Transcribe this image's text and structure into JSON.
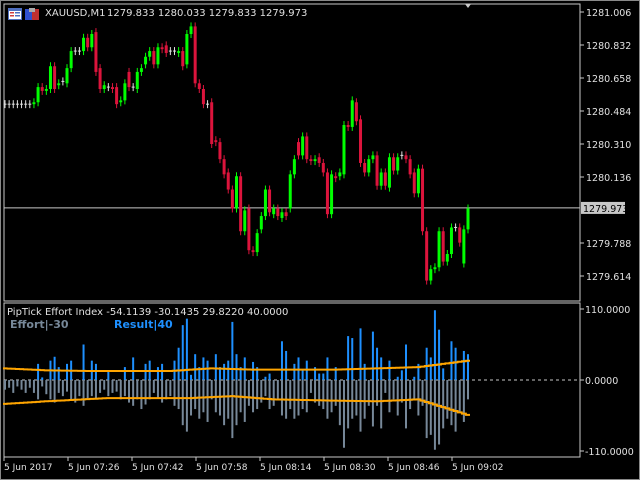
{
  "window": {
    "symbol_timeframe": "XAUUSD,M1",
    "ohlc_readout": "1279.833 1280.033 1279.833 1279.973",
    "current_price_label": "1279.973"
  },
  "indicator": {
    "title": "PipTick Effort Index -54.1139 -30.1435 29.8220 40.0000",
    "effort_label": "Effort|-30",
    "result_label": "Result|40",
    "axis_labels": [
      {
        "value": 110,
        "text": "110.0000"
      },
      {
        "value": 0,
        "text": "0.0000"
      },
      {
        "value": -110,
        "text": "-110.0000"
      }
    ]
  },
  "colors": {
    "bull": "#00ff00",
    "bear": "#dc143c",
    "doji": "#e0e0e0",
    "result": "#1e90ff",
    "effort": "#778899",
    "band": "#ffa500",
    "grid": "#c8c8c8"
  },
  "chart_data": {
    "type": "candlestick",
    "symbol": "XAUUSD",
    "timeframe": "M1",
    "price_axis_labels": [
      "1281.006",
      "1280.832",
      "1280.658",
      "1280.484",
      "1280.310",
      "1280.136",
      "1279.788",
      "1279.614"
    ],
    "current_price": 1279.973,
    "time_axis_labels": [
      "5 Jun 2017",
      "5 Jun 07:26",
      "5 Jun 07:42",
      "5 Jun 07:58",
      "5 Jun 08:14",
      "5 Jun 08:30",
      "5 Jun 08:46",
      "5 Jun 09:02"
    ],
    "candles_oc": [
      [
        1280.52,
        1280.52
      ],
      [
        1280.52,
        1280.52
      ],
      [
        1280.52,
        1280.52
      ],
      [
        1280.52,
        1280.52
      ],
      [
        1280.52,
        1280.52
      ],
      [
        1280.52,
        1280.52
      ],
      [
        1280.52,
        1280.52
      ],
      [
        1280.52,
        1280.53
      ],
      [
        1280.53,
        1280.61
      ],
      [
        1280.61,
        1280.59
      ],
      [
        1280.59,
        1280.6
      ],
      [
        1280.6,
        1280.72
      ],
      [
        1280.72,
        1280.6
      ],
      [
        1280.62,
        1280.63
      ],
      [
        1280.64,
        1280.64
      ],
      [
        1280.63,
        1280.71
      ],
      [
        1280.71,
        1280.8
      ],
      [
        1280.8,
        1280.8
      ],
      [
        1280.8,
        1280.8
      ],
      [
        1280.8,
        1280.87
      ],
      [
        1280.87,
        1280.82
      ],
      [
        1280.82,
        1280.89
      ],
      [
        1280.9,
        1280.69
      ],
      [
        1280.71,
        1280.6
      ],
      [
        1280.6,
        1280.62
      ],
      [
        1280.61,
        1280.61
      ],
      [
        1280.61,
        1280.6
      ],
      [
        1280.61,
        1280.52
      ],
      [
        1280.53,
        1280.54
      ],
      [
        1280.54,
        1280.63
      ],
      [
        1280.69,
        1280.61
      ],
      [
        1280.61,
        1280.61
      ],
      [
        1280.6,
        1280.69
      ],
      [
        1280.69,
        1280.71
      ],
      [
        1280.73,
        1280.77
      ],
      [
        1280.77,
        1280.8
      ],
      [
        1280.8,
        1280.73
      ],
      [
        1280.73,
        1280.82
      ],
      [
        1280.82,
        1280.81
      ],
      [
        1280.83,
        1280.79
      ],
      [
        1280.8,
        1280.8
      ],
      [
        1280.8,
        1280.8
      ],
      [
        1280.79,
        1280.8
      ],
      [
        1280.8,
        1280.72
      ],
      [
        1280.73,
        1280.89
      ],
      [
        1280.89,
        1280.93
      ],
      [
        1280.93,
        1280.63
      ],
      [
        1280.63,
        1280.6
      ],
      [
        1280.6,
        1280.52
      ],
      [
        1280.52,
        1280.52
      ],
      [
        1280.53,
        1280.31
      ],
      [
        1280.33,
        1280.32
      ],
      [
        1280.32,
        1280.23
      ],
      [
        1280.23,
        1280.15
      ],
      [
        1280.16,
        1280.07
      ],
      [
        1280.07,
        1279.97
      ],
      [
        1279.97,
        1280.14
      ],
      [
        1280.14,
        1279.85
      ],
      [
        1279.85,
        1279.96
      ],
      [
        1279.97,
        1279.75
      ],
      [
        1279.75,
        1279.74
      ],
      [
        1279.74,
        1279.84
      ],
      [
        1279.86,
        1279.93
      ],
      [
        1279.93,
        1280.07
      ],
      [
        1280.07,
        1279.95
      ],
      [
        1279.94,
        1279.97
      ],
      [
        1279.97,
        1279.93
      ],
      [
        1279.92,
        1279.95
      ],
      [
        1279.95,
        1279.93
      ],
      [
        1279.97,
        1280.15
      ],
      [
        1280.15,
        1280.23
      ],
      [
        1280.32,
        1280.25
      ],
      [
        1280.25,
        1280.35
      ],
      [
        1280.35,
        1280.23
      ],
      [
        1280.23,
        1280.22
      ],
      [
        1280.22,
        1280.23
      ],
      [
        1280.24,
        1280.21
      ],
      [
        1280.21,
        1280.16
      ],
      [
        1280.16,
        1279.94
      ],
      [
        1279.94,
        1280.15
      ],
      [
        1280.14,
        1280.13
      ],
      [
        1280.14,
        1280.16
      ],
      [
        1280.15,
        1280.41
      ],
      [
        1280.41,
        1280.4
      ],
      [
        1280.4,
        1280.54
      ],
      [
        1280.53,
        1280.43
      ],
      [
        1280.44,
        1280.21
      ],
      [
        1280.21,
        1280.16
      ],
      [
        1280.16,
        1280.23
      ],
      [
        1280.23,
        1280.25
      ],
      [
        1280.25,
        1280.09
      ],
      [
        1280.09,
        1280.16
      ],
      [
        1280.16,
        1280.09
      ],
      [
        1280.08,
        1280.24
      ],
      [
        1280.24,
        1280.17
      ],
      [
        1280.17,
        1280.24
      ],
      [
        1280.25,
        1280.25
      ],
      [
        1280.25,
        1280.23
      ],
      [
        1280.23,
        1280.15
      ],
      [
        1280.16,
        1280.05
      ],
      [
        1280.05,
        1280.18
      ],
      [
        1280.18,
        1279.85
      ],
      [
        1279.85,
        1279.59
      ],
      [
        1279.59,
        1279.65
      ],
      [
        1279.65,
        1279.66
      ],
      [
        1279.66,
        1279.85
      ],
      [
        1279.85,
        1279.69
      ],
      [
        1279.69,
        1279.73
      ],
      [
        1279.73,
        1279.87
      ],
      [
        1279.87,
        1279.87
      ],
      [
        1279.87,
        1279.79
      ],
      [
        1279.68,
        1279.86
      ],
      [
        1279.86,
        1279.97
      ]
    ],
    "indicator_result": [
      0,
      0,
      0,
      0,
      0,
      0,
      0,
      0,
      25,
      4,
      0,
      30,
      36,
      20,
      0,
      25,
      30,
      0,
      0,
      55,
      0,
      30,
      25,
      0,
      0,
      15,
      0,
      0,
      0,
      20,
      0,
      35,
      0,
      0,
      25,
      30,
      0,
      20,
      25,
      0,
      0,
      30,
      50,
      85,
      95,
      8,
      40,
      20,
      35,
      30,
      0,
      40,
      20,
      25,
      30,
      90,
      40,
      20,
      35,
      0,
      28,
      20,
      0,
      5,
      10,
      0,
      0,
      60,
      45,
      0,
      25,
      35,
      15,
      30,
      0,
      20,
      10,
      10,
      35,
      0,
      20,
      0,
      0,
      68,
      65,
      0,
      80,
      25,
      0,
      75,
      50,
      35,
      0,
      30,
      0,
      5,
      15,
      55,
      0,
      5,
      25,
      0,
      50,
      35,
      108,
      78,
      18,
      0,
      60,
      50,
      0,
      45,
      40
    ],
    "indicator_effort": [
      -15,
      -12,
      -20,
      -10,
      -15,
      -20,
      -12,
      -20,
      -30,
      -10,
      -22,
      -30,
      -35,
      -20,
      -25,
      -18,
      -30,
      -35,
      -25,
      -40,
      -30,
      -25,
      -30,
      -20,
      -15,
      -25,
      -20,
      -18,
      -30,
      -25,
      -35,
      -40,
      -30,
      -45,
      -38,
      -30,
      -20,
      -28,
      -35,
      -30,
      -25,
      -40,
      -45,
      -70,
      -80,
      -55,
      -45,
      -60,
      -50,
      -65,
      -30,
      -50,
      -55,
      -70,
      -60,
      -90,
      -70,
      -50,
      -65,
      -40,
      -50,
      -45,
      -35,
      -25,
      -45,
      -40,
      -30,
      -55,
      -60,
      -45,
      -60,
      -55,
      -45,
      -50,
      -20,
      -35,
      -40,
      -45,
      -60,
      -50,
      -40,
      -70,
      -105,
      -75,
      -60,
      -55,
      -80,
      -60,
      -40,
      -72,
      -40,
      -75,
      -20,
      -50,
      -30,
      -55,
      -35,
      -75,
      -45,
      -30,
      -55,
      -40,
      -90,
      -85,
      -108,
      -100,
      -75,
      -60,
      -70,
      -80,
      -50,
      -65,
      -30
    ],
    "upper_band_points": [
      [
        0,
        18
      ],
      [
        10,
        15
      ],
      [
        20,
        14
      ],
      [
        40,
        14
      ],
      [
        50,
        18
      ],
      [
        60,
        16
      ],
      [
        80,
        16
      ],
      [
        90,
        18
      ],
      [
        100,
        20
      ],
      [
        112,
        29.822
      ]
    ],
    "lower_band_points": [
      [
        0,
        -37
      ],
      [
        10,
        -33
      ],
      [
        25,
        -28
      ],
      [
        45,
        -28
      ],
      [
        55,
        -25
      ],
      [
        65,
        -30
      ],
      [
        80,
        -32
      ],
      [
        90,
        -33
      ],
      [
        100,
        -30
      ],
      [
        105,
        -40
      ],
      [
        112,
        -54.1139
      ]
    ],
    "indicator_range": [
      -110,
      110
    ]
  }
}
